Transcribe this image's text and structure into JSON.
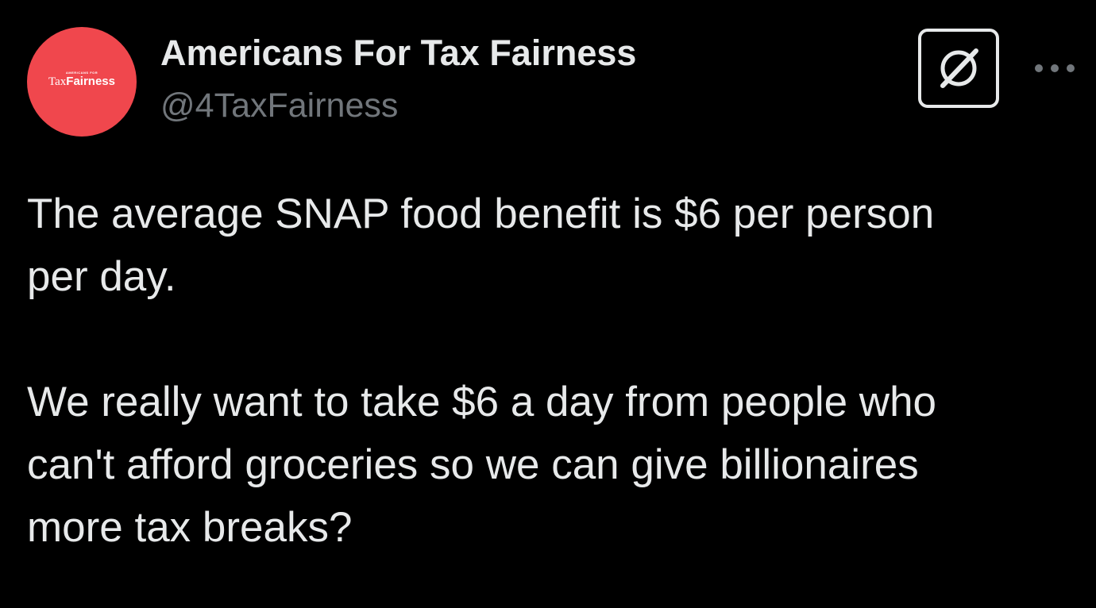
{
  "author": {
    "display_name": "Americans For Tax Fairness",
    "handle": "@4TaxFairness",
    "avatar": {
      "small_text": "Americans for",
      "word_tax": "Tax",
      "word_fairness": "Fairness",
      "background_color": "#f0474d"
    }
  },
  "actions": {
    "grok_icon": "grok-icon",
    "more_icon": "more-options-icon"
  },
  "tweet": {
    "paragraph_1": "The average SNAP food benefit is $6 per person\nper day.",
    "paragraph_2": "We really want to take $6 a day from people who\ncan't afford groceries so we can give billionaires\nmore tax breaks?"
  },
  "colors": {
    "background": "#000000",
    "primary_text": "#e7e9ea",
    "secondary_text": "#71767b"
  }
}
